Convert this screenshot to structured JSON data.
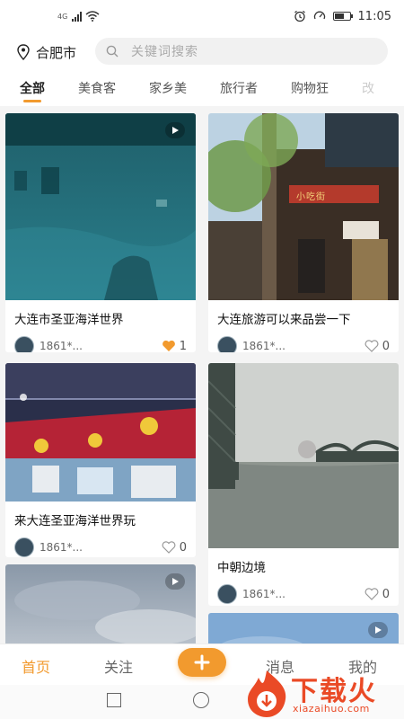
{
  "status_bar": {
    "network": "4G",
    "time": "11:05"
  },
  "header": {
    "location": "合肥市",
    "search_placeholder": "关键词搜索"
  },
  "tabs": [
    {
      "label": "全部",
      "active": true
    },
    {
      "label": "美食客",
      "active": false
    },
    {
      "label": "家乡美",
      "active": false
    },
    {
      "label": "旅行者",
      "active": false
    },
    {
      "label": "购物狂",
      "active": false
    },
    {
      "label": "改",
      "active": false
    }
  ],
  "cards": [
    {
      "title": "大连市圣亚海洋世界",
      "user": "1861*...",
      "likes": "1",
      "liked": true,
      "video": true
    },
    {
      "title": "大连旅游可以来品尝一下",
      "user": "1861*...",
      "likes": "0",
      "liked": false,
      "video": false
    },
    {
      "title": "来大连圣亚海洋世界玩",
      "user": "1861*...",
      "likes": "0",
      "liked": false,
      "video": false
    },
    {
      "title": "中朝边境",
      "user": "1861*...",
      "likes": "0",
      "liked": false,
      "video": false
    },
    {
      "title": "",
      "user": "",
      "likes": "",
      "liked": false,
      "video": true
    },
    {
      "title": "",
      "user": "",
      "likes": "",
      "liked": false,
      "video": true
    }
  ],
  "store_sign": "小吃街",
  "bottom_nav": {
    "home": "首页",
    "follow": "关注",
    "messages": "消息",
    "mine": "我的"
  },
  "watermark": {
    "text": "下载火",
    "url": "xiazaihuo.com"
  },
  "colors": {
    "accent": "#f29a2e",
    "liked": "#f29a2e",
    "watermark": "#ea4a26"
  }
}
